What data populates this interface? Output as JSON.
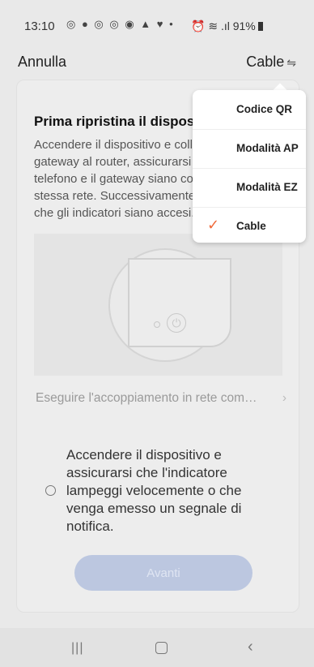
{
  "status": {
    "time": "13:10",
    "battery": "91%"
  },
  "nav": {
    "cancel": "Annulla",
    "mode": "Cable"
  },
  "content": {
    "title": "Prima ripristina il dispositivo",
    "desc_lines": [
      "Accendere il dispositivo e collegare il",
      "gateway al router, assicurarsi che il",
      "telefono e il gateway siano collegati alla",
      "stessa rete. Successivamente, verificare",
      "che gli indicatori siano accesi."
    ],
    "pairing_link": "Eseguire l'accoppiamento in rete com…",
    "confirm_lines": [
      "Accendere il dispositivo e",
      "assicurarsi che l'indicatore",
      "lampeggi velocemente o che",
      "venga emesso un segnale di",
      "notifica."
    ],
    "next_button": "Avanti"
  },
  "menu": {
    "items": [
      {
        "label": "Codice QR",
        "selected": false
      },
      {
        "label": "Modalità AP",
        "selected": false
      },
      {
        "label": "Modalità EZ",
        "selected": false
      },
      {
        "label": "Cable",
        "selected": true
      }
    ],
    "accent_color": "#f06a3a"
  }
}
